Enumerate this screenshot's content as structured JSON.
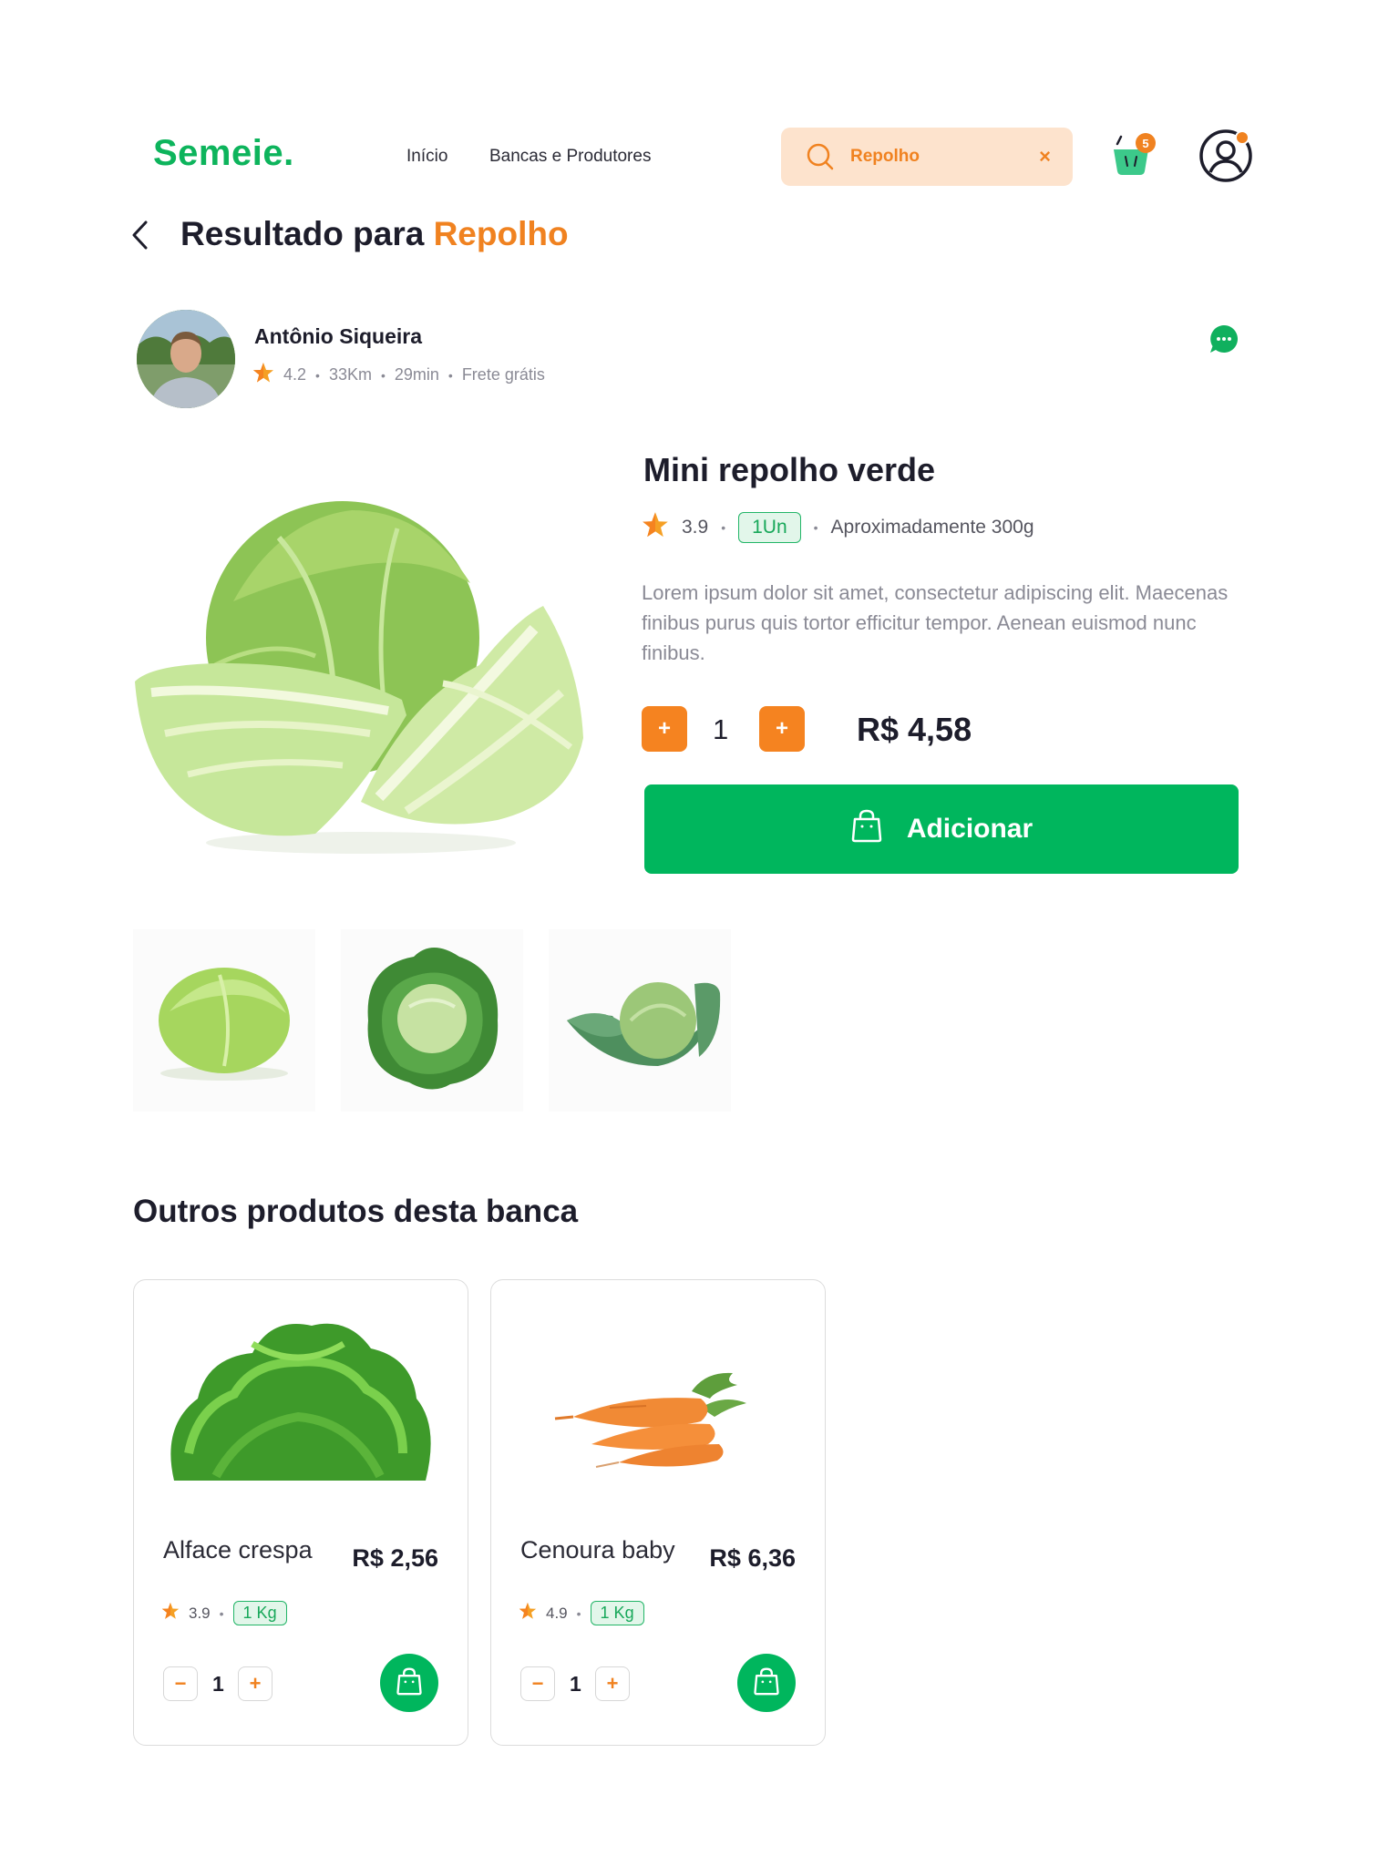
{
  "header": {
    "logo": "Semeie.",
    "nav": [
      "Início",
      "Bancas e Produtores"
    ],
    "search": {
      "value": "Repolho",
      "clear_label": "×"
    },
    "cart_count": "5"
  },
  "page": {
    "title_prefix": "Resultado para",
    "title_query": "Repolho"
  },
  "seller": {
    "name": "Antônio Siqueira",
    "rating": "4.2",
    "distance": "33Km",
    "time": "29min",
    "shipping": "Frete grátis"
  },
  "product": {
    "name": "Mini repolho verde",
    "rating": "3.9",
    "unit": "1Un",
    "weight": "Aproximadamente 300g",
    "description": "Lorem ipsum dolor sit amet, consectetur adipiscing elit. Maecenas finibus purus quis tortor efficitur tempor. Aenean euismod nunc finibus.",
    "quantity": "1",
    "decrement_label": "+",
    "increment_label": "+",
    "price": "R$ 4,58",
    "add_label": "Adicionar"
  },
  "other_section": {
    "title": "Outros produtos desta banca",
    "items": [
      {
        "name": "Alface crespa",
        "price": "R$ 2,56",
        "rating": "3.9",
        "unit": "1 Kg",
        "quantity": "1",
        "minus": "−",
        "plus": "+"
      },
      {
        "name": "Cenoura baby",
        "price": "R$ 6,36",
        "rating": "4.9",
        "unit": "1 Kg",
        "quantity": "1",
        "minus": "−",
        "plus": "+"
      }
    ]
  },
  "colors": {
    "brand_green": "#00b65d",
    "accent_orange": "#f08220",
    "search_bg": "#fde3cd"
  }
}
